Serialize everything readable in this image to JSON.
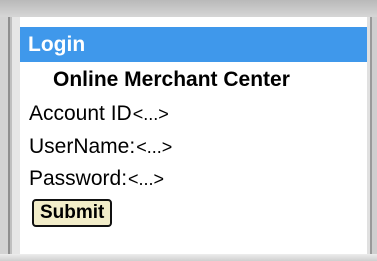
{
  "header": {
    "title": "Login"
  },
  "form": {
    "subtitle": "Online Merchant Center",
    "account_label": "Account ID",
    "account_value": "<...>",
    "username_label": "UserName:",
    "username_value": "<...>",
    "password_label": "Password:",
    "password_value": "<...>",
    "submit_label": "Submit"
  },
  "colors": {
    "title_bar": "#3f98eb",
    "button_fill": "#f2edc9"
  }
}
